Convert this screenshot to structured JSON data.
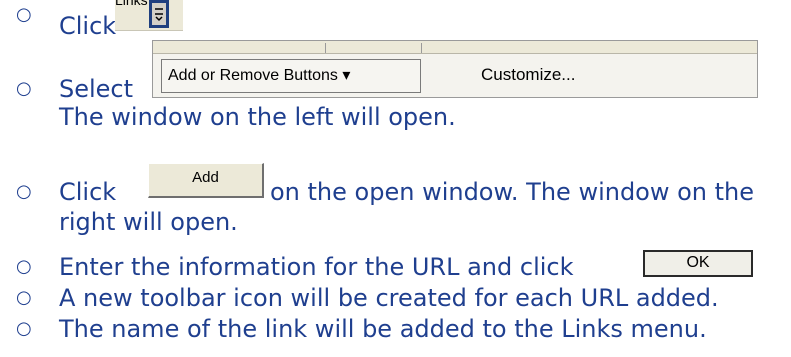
{
  "steps": [
    {
      "bullet": "o",
      "text": "Click"
    },
    {
      "bullet": "o",
      "text": "Select"
    },
    {
      "text": "The window on the left will open."
    },
    {
      "bullet": "o",
      "text_before": "Click",
      "text_after": "on the open window. The window on the",
      "text_line2": "right will open."
    },
    {
      "bullet": "o",
      "text": "Enter the information for the URL and click"
    },
    {
      "bullet": "o",
      "text": "A new toolbar icon will be created for each URL added."
    },
    {
      "bullet": "o",
      "text": "The name of the link will be added to the Links menu."
    }
  ],
  "links_toolbar": {
    "label": "Links"
  },
  "menu": {
    "add_remove_label": "Add or Remove Buttons ▾",
    "customize_label": "Customize..."
  },
  "buttons": {
    "add_label": "Add",
    "ok_label": "OK"
  }
}
